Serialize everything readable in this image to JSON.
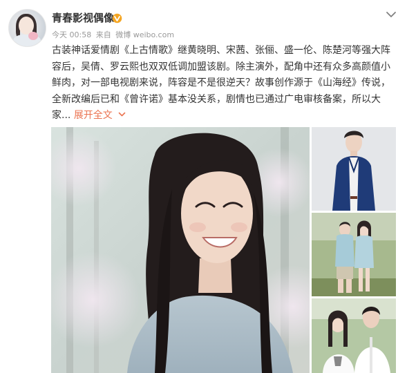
{
  "post": {
    "author": "青春影视偶像",
    "author_badge": "v-badge-icon",
    "timestamp": "今天 00:58",
    "source_prefix": "来自",
    "source": "微博 weibo.com",
    "content_lines": [
      "古装神话爱情剧《上古情歌》继黄晓明、宋茜、张俪、盛一伦、陈楚河等强大阵",
      "容后，吴倩、罗云熙也双双低调加盟该剧。除主演外，配角中还有众多高颜值小",
      "鲜肉，对一部电视剧来说，阵容是不是很逆天？故事创作源于《山海经》传说，",
      "全新改编后已和《曾许诺》基本没关系，剧情也已通过广电审核备案，所以大",
      "家..."
    ],
    "expand_label": "展开全文",
    "expand_icon": "chevron-down-icon"
  },
  "colors": {
    "link": "#eb7350",
    "text": "#333333",
    "meta": "#999999",
    "badge": "#f5a623"
  },
  "icons": {
    "more": "chevron-down-icon"
  }
}
